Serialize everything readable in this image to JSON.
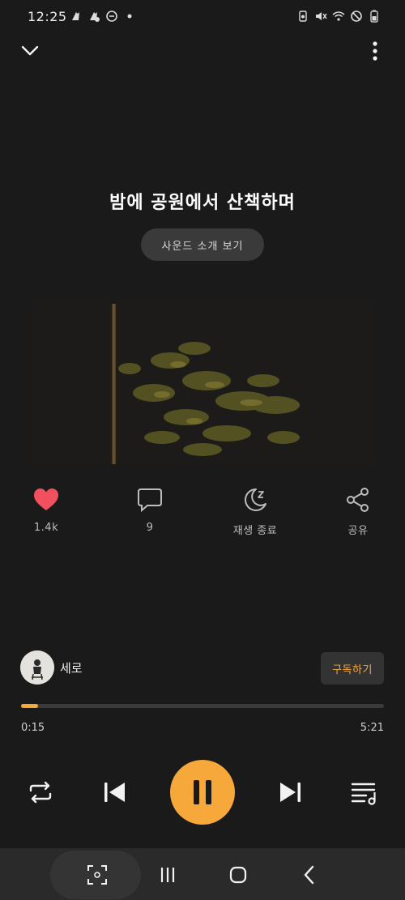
{
  "status_bar": {
    "time": "12:25",
    "left_icons": [
      "notification-app-icon",
      "notification-app-icon-2",
      "do-not-disturb-icon",
      "dot-icon"
    ],
    "right_icons": [
      "battery-saver-icon",
      "mute-vibrate-icon",
      "wifi-icon",
      "blocked-icon",
      "battery-icon"
    ]
  },
  "header": {
    "collapse_icon": "chevron-down-icon",
    "more_icon": "more-vertical-icon"
  },
  "track": {
    "title": "밤에 공원에서 산책하며",
    "intro_button": "사운드 소개 보기"
  },
  "actions": {
    "like_count": "1.4k",
    "comment_count": "9",
    "sleep_timer_label": "재생 종료",
    "share_label": "공유"
  },
  "creator": {
    "name": "세로",
    "subscribe_label": "구독하기"
  },
  "playback": {
    "current_time": "0:15",
    "total_time": "5:21",
    "progress": 0.047
  },
  "colors": {
    "accent": "#f6a83b",
    "like": "#f2505e",
    "background": "#1a1a1a"
  }
}
